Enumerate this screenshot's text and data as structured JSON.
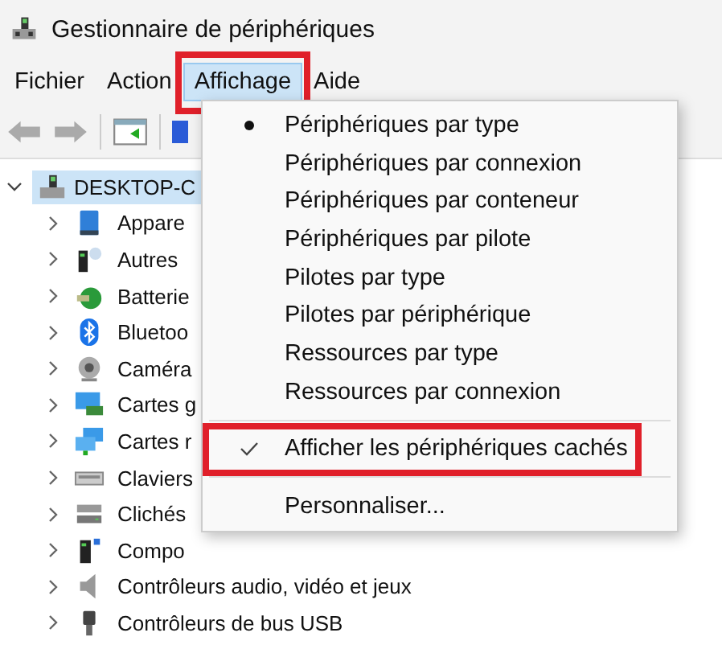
{
  "window": {
    "title": "Gestionnaire de périphériques"
  },
  "menu_bar": [
    {
      "label": "Fichier",
      "selected": false
    },
    {
      "label": "Action",
      "selected": false
    },
    {
      "label": "Affichage",
      "selected": true
    },
    {
      "label": "Aide",
      "selected": false
    }
  ],
  "tree": {
    "root": {
      "label": "DESKTOP-C",
      "expanded": true,
      "selected": true,
      "children": [
        {
          "label": "Appare",
          "expanded": false,
          "selected": false
        },
        {
          "label": "Autres",
          "expanded": false,
          "selected": false
        },
        {
          "label": "Batterie",
          "expanded": false,
          "selected": false
        },
        {
          "label": "Bluetoo",
          "expanded": false,
          "selected": false
        },
        {
          "label": "Caméra",
          "expanded": false,
          "selected": false
        },
        {
          "label": "Cartes g",
          "expanded": false,
          "selected": false
        },
        {
          "label": "Cartes r",
          "expanded": false,
          "selected": false
        },
        {
          "label": "Claviers",
          "expanded": false,
          "selected": false
        },
        {
          "label": "Clichés",
          "expanded": false,
          "selected": false
        },
        {
          "label": "Compo",
          "expanded": false,
          "selected": false
        },
        {
          "label": "Contrôleurs audio, vidéo et jeux",
          "expanded": false,
          "selected": false
        },
        {
          "label": "Contrôleurs de bus USB",
          "expanded": false,
          "selected": false
        }
      ]
    }
  },
  "dropdown": {
    "items": [
      {
        "kind": "radio",
        "label": "Périphériques par type",
        "selected": true
      },
      {
        "kind": "radio",
        "label": "Périphériques par connexion",
        "selected": false
      },
      {
        "kind": "radio",
        "label": "Périphériques par conteneur",
        "selected": false
      },
      {
        "kind": "radio",
        "label": "Périphériques par pilote",
        "selected": false
      },
      {
        "kind": "radio",
        "label": "Pilotes par type",
        "selected": false
      },
      {
        "kind": "radio",
        "label": "Pilotes par périphérique",
        "selected": false
      },
      {
        "kind": "radio",
        "label": "Ressources par type",
        "selected": false
      },
      {
        "kind": "radio",
        "label": "Ressources par connexion",
        "selected": false
      },
      {
        "kind": "separator"
      },
      {
        "kind": "check",
        "label": "Afficher les périphériques cachés",
        "checked": true,
        "highlighted": true
      },
      {
        "kind": "separator"
      },
      {
        "kind": "plain",
        "label": "Personnaliser..."
      }
    ]
  }
}
